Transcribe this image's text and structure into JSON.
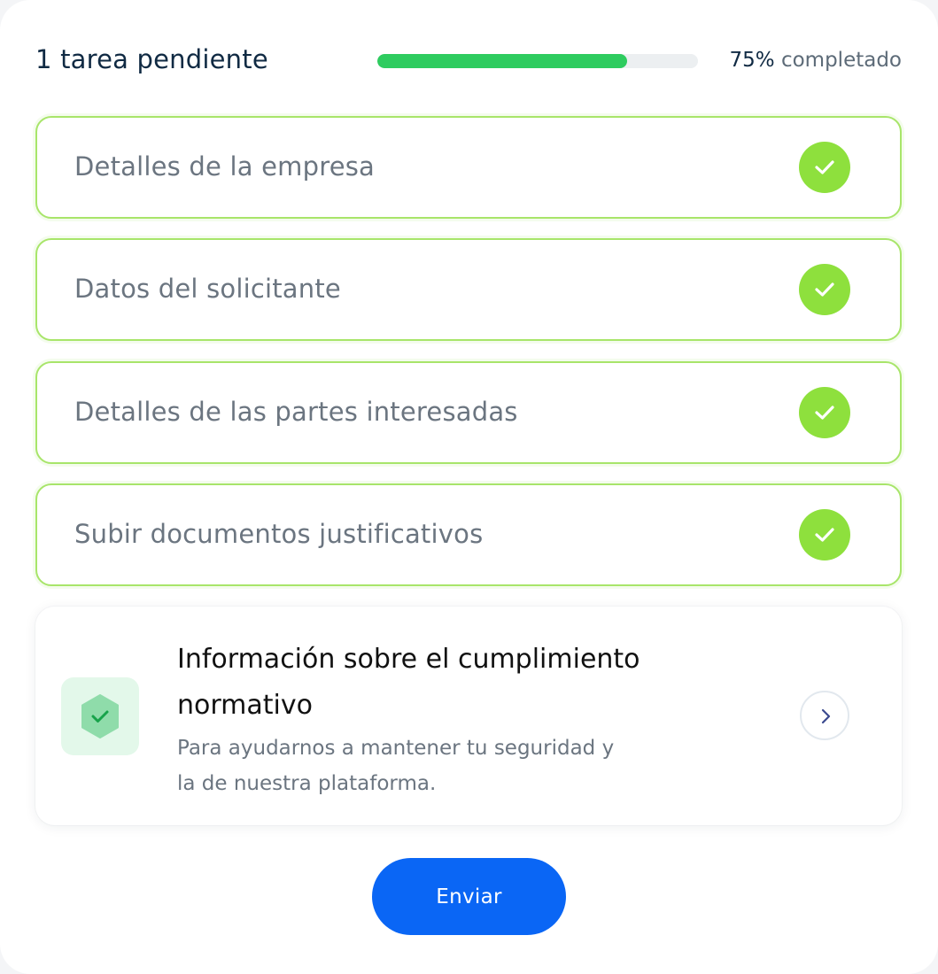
{
  "header": {
    "pending_text": "1 tarea pendiente",
    "progress_fraction": 0.78,
    "progress_value": "75%",
    "progress_suffix": "completado"
  },
  "tasks": [
    {
      "label": "Detalles de la empresa",
      "status": "completed"
    },
    {
      "label": "Datos del solicitante",
      "status": "completed"
    },
    {
      "label": "Detalles de las partes interesadas",
      "status": "completed"
    },
    {
      "label": "Subir documentos justificativos",
      "status": "completed"
    }
  ],
  "compliance": {
    "title": "Información sobre el cumplimiento normativo",
    "description": "Para ayudarnos a mantener tu seguridad y la de nuestra plataforma.",
    "icon": "shield-check-icon"
  },
  "submit": {
    "label": "Enviar"
  },
  "colors": {
    "progress": "#2ecc5f",
    "task_border": "#a8e56a",
    "check": "#8ee03d",
    "primary_button": "#0a66f5"
  }
}
